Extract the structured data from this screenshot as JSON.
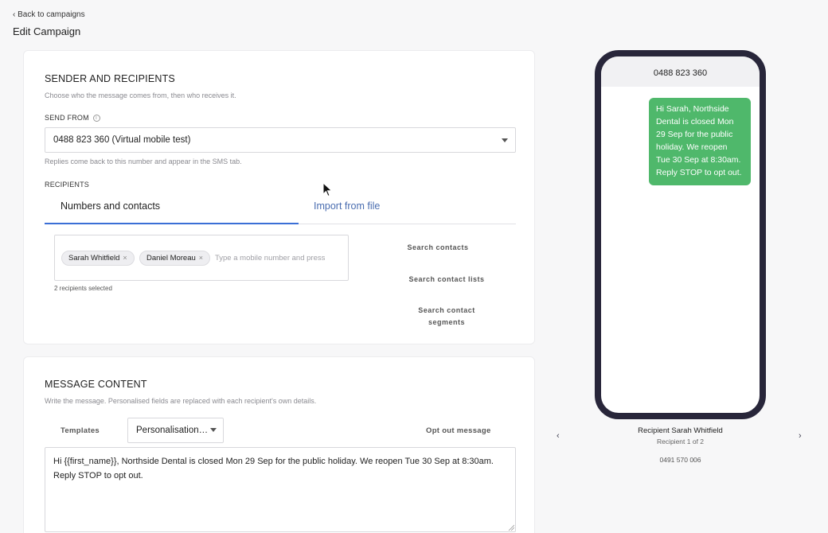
{
  "nav": {
    "back_label": "‹ Back to campaigns"
  },
  "page": {
    "title": "Edit Campaign"
  },
  "sender_section": {
    "title": "SENDER AND RECIPIENTS",
    "subtitle": "Choose who the message comes from, then who receives it.",
    "send_from_label": "SEND FROM",
    "info_icon": "ⓘ",
    "send_from_value": "0488 823 360 (Virtual mobile test)",
    "send_from_hint": "Replies come back to this number and appear in the SMS tab.",
    "recipients_label": "RECIPIENTS",
    "tabs": [
      {
        "label": "Numbers and contacts",
        "active": true
      },
      {
        "label": "Import from file",
        "active": false
      }
    ],
    "chips": [
      {
        "name": "Sarah Whitfield",
        "remove": "×"
      },
      {
        "name": "Daniel Moreau",
        "remove": "×"
      }
    ],
    "recipient_input_placeholder": "Type a mobile number and press",
    "recipient_count": "2 recipients selected",
    "side_buttons": {
      "search_contacts": "Search contacts",
      "search_lists": "Search contact lists",
      "search_segments_line1": "Search contact",
      "search_segments_line2": "segments"
    }
  },
  "message_section": {
    "title": "MESSAGE CONTENT",
    "subtitle": "Write the message. Personalised fields are replaced with each recipient's own details.",
    "templates_label": "Templates",
    "personalisation_label": "Personalisation…",
    "opt_out_label": "Opt out message",
    "message_text": "Hi {{first_name}}, Northside Dental is closed Mon 29 Sep for the public holiday. We reopen Tue 30 Sep at 8:30am. Reply STOP to opt out."
  },
  "preview": {
    "phone_number": "0488 823 360",
    "bubble_text": "Hi Sarah, Northside Dental is closed Mon 29 Sep for the public holiday. We reopen Tue 30 Sep at 8:30am. Reply STOP to opt out.",
    "recipient_name": "Recipient Sarah Whitfield",
    "recipient_position": "Recipient 1 of 2",
    "recipient_number": "0491 570 006",
    "prev_arrow": "‹",
    "next_arrow": "›"
  },
  "colors": {
    "accent": "#3b6fd6",
    "bubble": "#4fb86b",
    "phone_frame": "#28263a"
  }
}
